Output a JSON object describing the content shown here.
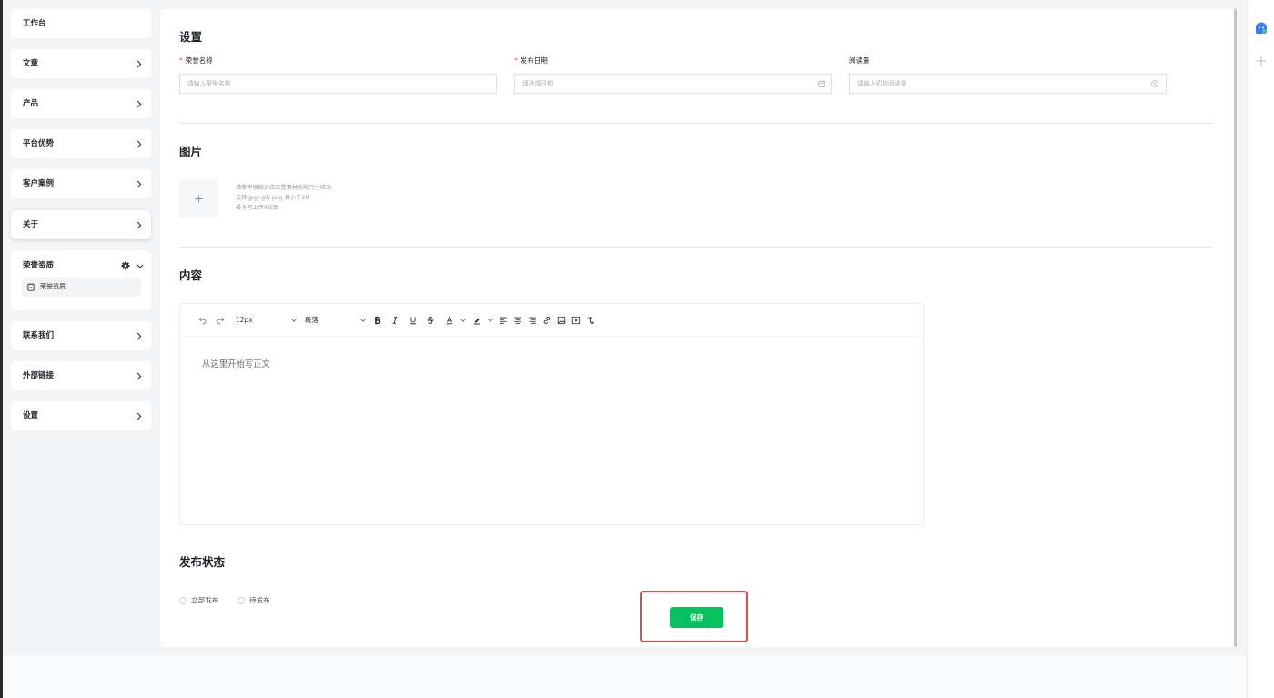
{
  "sidebar": {
    "items": [
      {
        "label": "工作台",
        "has_children": false
      },
      {
        "label": "文章",
        "has_children": true
      },
      {
        "label": "产品",
        "has_children": true
      },
      {
        "label": "平台优势",
        "has_children": true
      },
      {
        "label": "客户案例",
        "has_children": true
      },
      {
        "label": "关于",
        "has_children": true
      },
      {
        "label": "荣誉资质",
        "has_children": true,
        "expanded": true,
        "children": [
          {
            "label": "荣誉资质",
            "active": true,
            "icon": "badge-icon"
          }
        ]
      },
      {
        "label": "联系我们",
        "has_children": true
      },
      {
        "label": "外部链接",
        "has_children": true
      },
      {
        "label": "设置",
        "has_children": true
      }
    ]
  },
  "form": {
    "required_mark": "*",
    "settings": {
      "title": "设置",
      "fields": [
        {
          "label": "荣誉名称",
          "required": true,
          "placeholder": "请输入荣誉名称",
          "value": ""
        },
        {
          "label": "发布日期",
          "required": true,
          "placeholder": "请选择日期",
          "value": "",
          "suffix_icon": "calendar-icon"
        },
        {
          "label": "阅读量",
          "required": false,
          "placeholder": "请输入初始阅读量",
          "value": "",
          "suffix_icon": "clock-icon"
        }
      ]
    },
    "images": {
      "title": "图片",
      "upload_icon": "plus-icon",
      "hints": [
        "请参考模版对应位置素材实际尺寸修改",
        "支持.jpg/.gif/.png 且小于1M",
        "最多可上传9张图"
      ]
    },
    "content": {
      "title": "内容",
      "editor": {
        "font_size": "12px",
        "block_format": "段落",
        "placeholder": "从这里开始写正文",
        "toolbar_icons": [
          "undo-icon",
          "redo-icon",
          "font-size-select",
          "block-format-select",
          "bold-icon",
          "italic-icon",
          "underline-icon",
          "strikethrough-icon",
          "font-color-icon",
          "highlight-icon",
          "align-left-icon",
          "align-center-icon",
          "align-right-icon",
          "link-icon",
          "image-icon",
          "video-icon",
          "clear-format-icon"
        ]
      }
    },
    "publish": {
      "title": "发布状态",
      "options": [
        {
          "label": "立部发布",
          "selected": false
        },
        {
          "label": "待发布",
          "selected": false
        }
      ]
    },
    "save_label": "保存"
  },
  "side_tools": {
    "icons": [
      "assistant-bot-icon",
      "plus-icon"
    ]
  },
  "colors": {
    "primary_green": "#07c160",
    "required_red": "#f54a45",
    "highlight_red": "#e5484d",
    "page_bg": "#f3f4f6",
    "assistant_blue": "#3a7bf5"
  }
}
